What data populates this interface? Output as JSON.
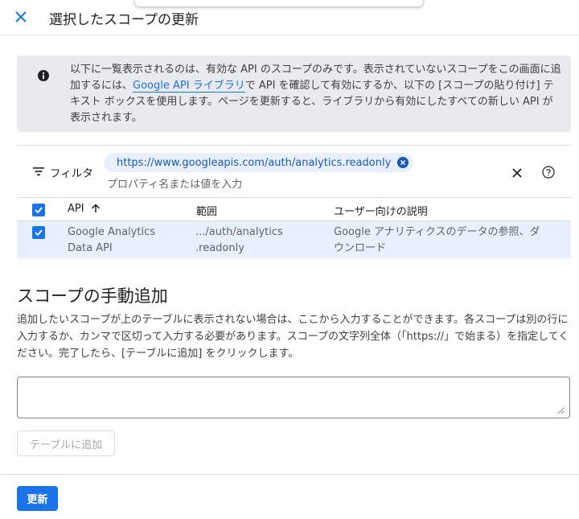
{
  "header": {
    "title": "選択したスコープの更新"
  },
  "info": {
    "text_before_link": "以下に一覧表示されるのは、有効な API のスコープのみです。表示されていないスコープをこの画面に追加するには、",
    "link_text": "Google API ライブラリ",
    "text_after_link": "で API を確認して有効にするか、以下の [スコープの貼り付け] テキスト ボックスを使用します。ページを更新すると、ライブラリから有効にしたすべての新しい API が表示されます。"
  },
  "filter": {
    "label": "フィルタ",
    "chip_value": "https://www.googleapis.com/auth/analytics.readonly",
    "placeholder": "プロパティ名または値を入力"
  },
  "table": {
    "columns": {
      "api": "API",
      "scope": "範囲",
      "description": "ユーザー向けの説明"
    },
    "rows": [
      {
        "checked": true,
        "api_line1": "Google Analytics",
        "api_line2": "Data API",
        "scope_line1": ".../auth/analytics",
        "scope_line2": ".readonly",
        "desc_line1": "Google アナリティクスのデータの参照、ダ",
        "desc_line2": "ウンロード"
      }
    ]
  },
  "manual": {
    "title": "スコープの手動追加",
    "description": "追加したいスコープが上のテーブルに表示されない場合は、ここから入力することができます。各スコープは別の行に入力するか、カンマで区切って入力する必要があります。スコープの文字列全体（「https://」で始まる）を指定してください。完了したら、[テーブルに追加] をクリックします。",
    "textarea_value": "",
    "add_button": "テーブルに追加"
  },
  "footer": {
    "update_button": "更新"
  },
  "colors": {
    "primary": "#1a73e8",
    "info_bg": "#e8eaed",
    "selected_row_bg": "#e8f0fe"
  },
  "icons": {
    "close": "close-icon",
    "info": "info-icon",
    "filter": "filter-list-icon",
    "chip_remove": "cancel-icon",
    "clear": "close-icon",
    "help": "help-outline-icon",
    "sort": "arrow-upward-icon",
    "checkbox": "checkbox-checked-icon"
  }
}
